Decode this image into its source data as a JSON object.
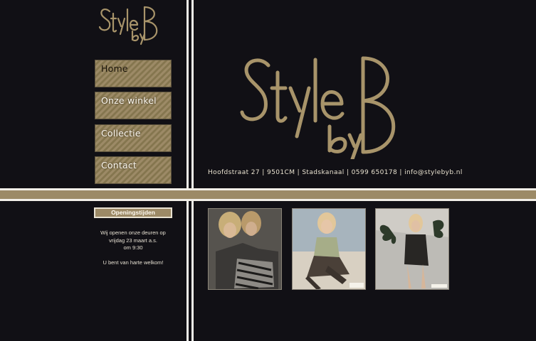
{
  "brand": {
    "logo_text_main": "StyleB",
    "logo_text_sub": "by",
    "colors": {
      "gold": "#9c8a66",
      "background": "#111015",
      "divider": "#f2efe8"
    }
  },
  "nav": {
    "items": [
      {
        "label": "Home",
        "active": true
      },
      {
        "label": "Onze winkel",
        "active": false
      },
      {
        "label": "Collectie",
        "active": false
      },
      {
        "label": "Contact",
        "active": false
      }
    ]
  },
  "address": {
    "text": "Hoofdstraat 27  |  9501CM  |  Stadskanaal  |  0599 650178  |  info@stylebyb.nl"
  },
  "opening": {
    "header": "Openingstijden",
    "line1": "Wij openen onze deuren op",
    "line2": "vrijdag 23 maart a.s.",
    "line3": "om 9:30",
    "welcome": "U bent van harte welkom!"
  },
  "gallery": {
    "photos": [
      {
        "icon": "photo-woman-zebra-dress"
      },
      {
        "icon": "photo-woman-sitting"
      },
      {
        "icon": "photo-woman-palm-leaves"
      }
    ]
  }
}
